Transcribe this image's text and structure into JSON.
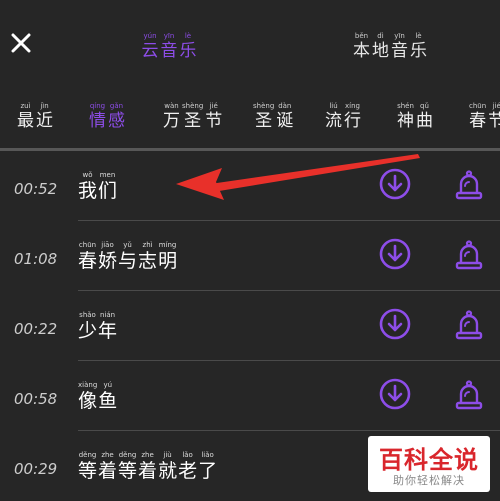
{
  "colors": {
    "accent": "#8d4de8",
    "background": "#262626",
    "annotation": "#e8302a"
  },
  "header": {
    "close_icon": "close-icon",
    "tabs": [
      {
        "words": [
          {
            "py": "yún",
            "hz": "云"
          },
          {
            "py": "yīn",
            "hz": "音"
          },
          {
            "py": "lè",
            "hz": "乐"
          }
        ],
        "active": true
      },
      {
        "words": [
          {
            "py": "běn",
            "hz": "本"
          },
          {
            "py": "dì",
            "hz": "地"
          },
          {
            "py": "yīn",
            "hz": "音"
          },
          {
            "py": "lè",
            "hz": "乐"
          }
        ],
        "active": false
      }
    ]
  },
  "categories": [
    {
      "words": [
        {
          "py": "zuì",
          "hz": "最"
        },
        {
          "py": "jìn",
          "hz": "近"
        }
      ],
      "active": false
    },
    {
      "words": [
        {
          "py": "qíng",
          "hz": "情"
        },
        {
          "py": "gǎn",
          "hz": "感"
        }
      ],
      "active": true
    },
    {
      "words": [
        {
          "py": "wàn",
          "hz": "万"
        },
        {
          "py": "shèng",
          "hz": "圣"
        },
        {
          "py": "jié",
          "hz": "节"
        }
      ],
      "active": false
    },
    {
      "words": [
        {
          "py": "shèng",
          "hz": "圣"
        },
        {
          "py": "dàn",
          "hz": "诞"
        }
      ],
      "active": false
    },
    {
      "words": [
        {
          "py": "liú",
          "hz": "流"
        },
        {
          "py": "xíng",
          "hz": "行"
        }
      ],
      "active": false
    },
    {
      "words": [
        {
          "py": "shén",
          "hz": "神"
        },
        {
          "py": "qǔ",
          "hz": "曲"
        }
      ],
      "active": false
    },
    {
      "words": [
        {
          "py": "chūn",
          "hz": "春"
        },
        {
          "py": "jié",
          "hz": "节"
        }
      ],
      "active": false
    }
  ],
  "songs": [
    {
      "time": "00:52",
      "words": [
        {
          "py": "wǒ",
          "hz": "我"
        },
        {
          "py": "men",
          "hz": "们"
        }
      ]
    },
    {
      "time": "01:08",
      "words": [
        {
          "py": "chūn",
          "hz": "春"
        },
        {
          "py": "jiāo",
          "hz": "娇"
        },
        {
          "py": "yǔ",
          "hz": "与"
        },
        {
          "py": "zhì",
          "hz": "志"
        },
        {
          "py": "míng",
          "hz": "明"
        }
      ]
    },
    {
      "time": "00:22",
      "words": [
        {
          "py": "shǎo",
          "hz": "少"
        },
        {
          "py": "nián",
          "hz": "年"
        }
      ]
    },
    {
      "time": "00:58",
      "words": [
        {
          "py": "xiàng",
          "hz": "像"
        },
        {
          "py": "yú",
          "hz": "鱼"
        }
      ]
    },
    {
      "time": "00:29",
      "words": [
        {
          "py": "děng",
          "hz": "等"
        },
        {
          "py": "zhe",
          "hz": "着"
        },
        {
          "py": "děng",
          "hz": "等"
        },
        {
          "py": "zhe",
          "hz": "着"
        },
        {
          "py": "jiù",
          "hz": "就"
        },
        {
          "py": "lǎo",
          "hz": "老"
        },
        {
          "py": "liǎo",
          "hz": "了"
        }
      ]
    }
  ],
  "icons": {
    "download": "download-icon",
    "bell": "bell-icon"
  },
  "watermark": {
    "title": "百科全说",
    "subtitle": "助你轻松解决"
  }
}
